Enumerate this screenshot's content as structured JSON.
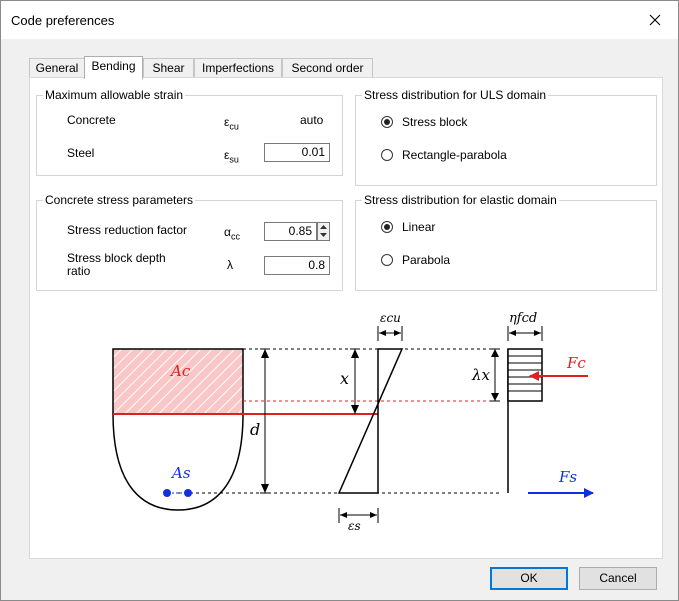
{
  "window": {
    "title": "Code preferences"
  },
  "tabs": [
    {
      "label": "General",
      "active": false
    },
    {
      "label": "Bending",
      "active": true
    },
    {
      "label": "Shear",
      "active": false
    },
    {
      "label": "Imperfections",
      "active": false
    },
    {
      "label": "Second order",
      "active": false
    }
  ],
  "strain": {
    "title": "Maximum allowable strain",
    "concrete_label": "Concrete",
    "concrete_sym": "ε",
    "concrete_sub": "cu",
    "concrete_value": "auto",
    "steel_label": "Steel",
    "steel_sym": "ε",
    "steel_sub": "su",
    "steel_value": "0.01"
  },
  "params": {
    "title": "Concrete stress parameters",
    "reduction_label": "Stress reduction factor",
    "reduction_sym": "α",
    "reduction_sub": "cc",
    "reduction_value": "0.85",
    "depth_label_1": "Stress block depth",
    "depth_label_2": "ratio",
    "depth_sym": "λ",
    "depth_value": "0.8"
  },
  "uls": {
    "title": "Stress distribution for ULS domain",
    "options": [
      {
        "label": "Stress block",
        "checked": true
      },
      {
        "label": "Rectangle-parabola",
        "checked": false
      }
    ]
  },
  "elastic": {
    "title": "Stress distribution for elastic domain",
    "options": [
      {
        "label": "Linear",
        "checked": true
      },
      {
        "label": "Parabola",
        "checked": false
      }
    ]
  },
  "diagram": {
    "ac": "Ac",
    "as": "As",
    "d": "d",
    "x": "x",
    "lx": "λx",
    "ecu": "εcu",
    "es": "εs",
    "nfcd": "ηfcd",
    "fc": "Fc",
    "fs": "Fs",
    "colors": {
      "compression": "#e02020",
      "steel": "#1030e0",
      "hatch_fill": "#f9c7c7"
    }
  },
  "buttons": {
    "ok": "OK",
    "cancel": "Cancel"
  }
}
